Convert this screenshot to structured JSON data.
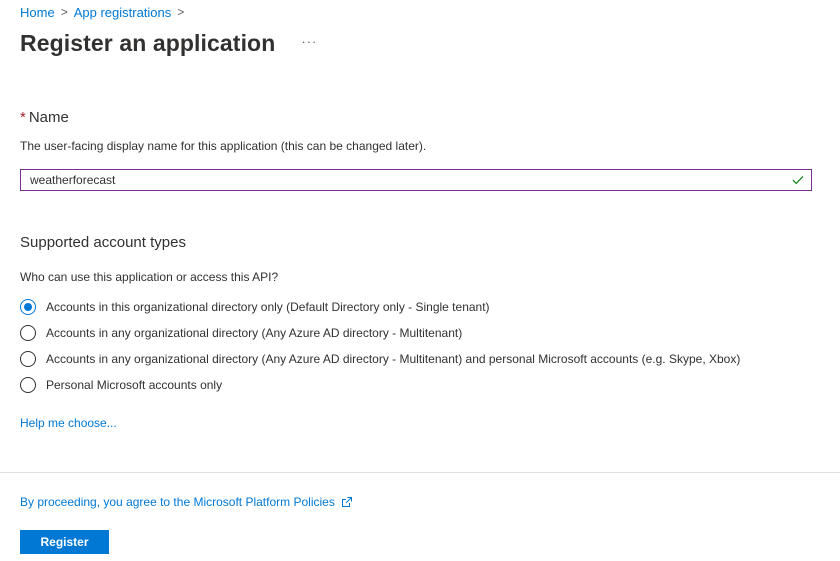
{
  "breadcrumb": {
    "items": [
      {
        "label": "Home"
      },
      {
        "label": "App registrations"
      }
    ],
    "separator": ">"
  },
  "header": {
    "title": "Register an application",
    "more_label": "···"
  },
  "name_section": {
    "required_mark": "*",
    "label": "Name",
    "description": "The user-facing display name for this application (this can be changed later).",
    "input_value": "weatherforecast",
    "validation_icon": "checkmark-icon",
    "validation_color": "#107c10",
    "focus_border_color": "#7a2e8e"
  },
  "account_types": {
    "heading": "Supported account types",
    "question": "Who can use this application or access this API?",
    "options": [
      {
        "label": "Accounts in this organizational directory only (Default Directory only - Single tenant)",
        "checked": true
      },
      {
        "label": "Accounts in any organizational directory (Any Azure AD directory - Multitenant)",
        "checked": false
      },
      {
        "label": "Accounts in any organizational directory (Any Azure AD directory - Multitenant) and personal Microsoft accounts (e.g. Skype, Xbox)",
        "checked": false
      },
      {
        "label": "Personal Microsoft accounts only",
        "checked": false
      }
    ],
    "help_link": "Help me choose..."
  },
  "footer": {
    "policy_text": "By proceeding, you agree to the Microsoft Platform Policies",
    "policy_icon": "external-link-icon",
    "register_label": "Register"
  },
  "colors": {
    "accent": "#0078d4",
    "required": "#a4262c",
    "text": "#323130",
    "divider": "#e1dfdd"
  }
}
